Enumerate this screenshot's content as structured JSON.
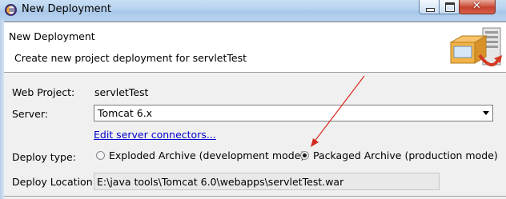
{
  "window": {
    "title": "New Deployment"
  },
  "banner": {
    "title": "New Deployment",
    "description": "Create new project deployment for servletTest"
  },
  "form": {
    "project_label": "Web Project:",
    "project_value": "servletTest",
    "server_label": "Server:",
    "server_selected": "Tomcat  6.x",
    "edit_connectors_link": "Edit server connectors...",
    "deploy_type_label": "Deploy type:",
    "deploy_options": [
      {
        "label": "Exploded Archive (development mode)",
        "checked": false
      },
      {
        "label": "Packaged Archive (production mode)",
        "checked": true
      }
    ],
    "location_label": "Deploy Location:",
    "location_value": "E:\\java tools\\Tomcat 6.0\\webapps\\servletTest.war"
  },
  "icons": {
    "app": "eclipse-icon",
    "banner": "deployment-wizard-icon"
  },
  "colors": {
    "link": "#0000cc",
    "annotation_arrow": "#d42a1e"
  }
}
